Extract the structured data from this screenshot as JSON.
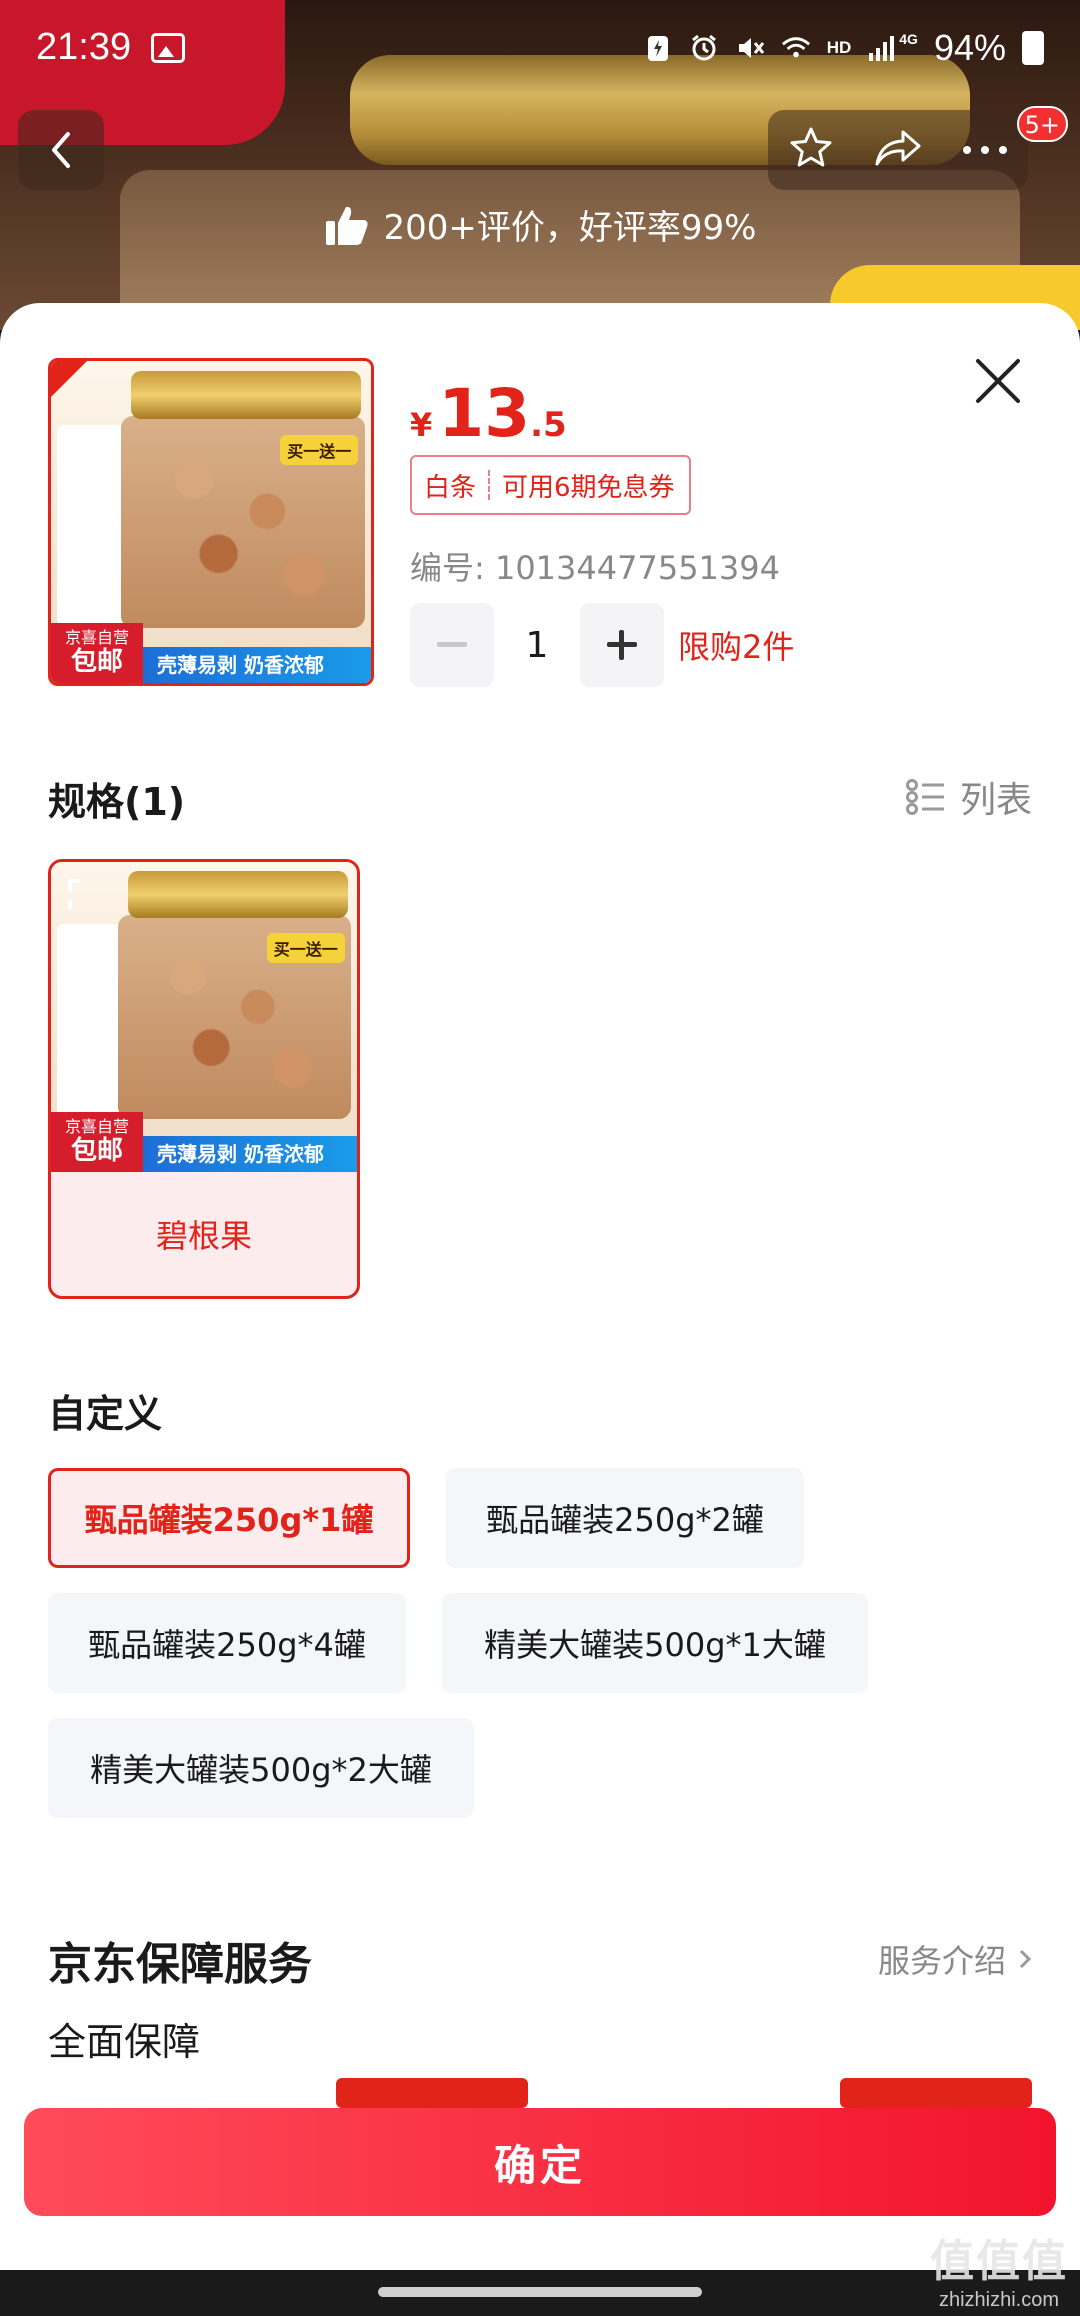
{
  "status": {
    "time": "21:39",
    "network_label": "HD",
    "network_gen": "4G",
    "battery": "94%"
  },
  "header": {
    "cart_badge": "5+",
    "review_banner": "200+评价，好评率99%"
  },
  "product": {
    "price_currency": "¥",
    "price_integer": "13",
    "price_decimal": ".5",
    "coupon_a": "白条",
    "coupon_b": "可用6期免息券",
    "sku_number": "编号: 10134477551394",
    "quantity": "1",
    "limit": "限购2件",
    "image_badge": "买一送一",
    "image_label_top": "京喜自营",
    "image_label_main": "包邮",
    "image_slogan": "壳薄易剥 奶香浓郁"
  },
  "spec": {
    "title": "规格(1)",
    "list_toggle": "列表",
    "items": [
      {
        "name": "碧根果"
      }
    ]
  },
  "custom": {
    "title": "自定义",
    "options": [
      {
        "label": "甄品罐装250g*1罐",
        "selected": true
      },
      {
        "label": "甄品罐装250g*2罐",
        "selected": false
      },
      {
        "label": "甄品罐装250g*4罐",
        "selected": false
      },
      {
        "label": "精美大罐装500g*1大罐",
        "selected": false
      },
      {
        "label": "精美大罐装500g*2大罐",
        "selected": false
      }
    ]
  },
  "guarantee": {
    "title": "京东保障服务",
    "link": "服务介绍",
    "subtitle": "全面保障"
  },
  "footer": {
    "confirm": "确定"
  },
  "watermark": {
    "big": "值值值",
    "small": "zhizhizhi.com"
  },
  "colors": {
    "accent": "#e2231a",
    "confirm_start": "#ff4b5a",
    "confirm_end": "#f2142c",
    "chip_bg": "#f5f6fa"
  }
}
